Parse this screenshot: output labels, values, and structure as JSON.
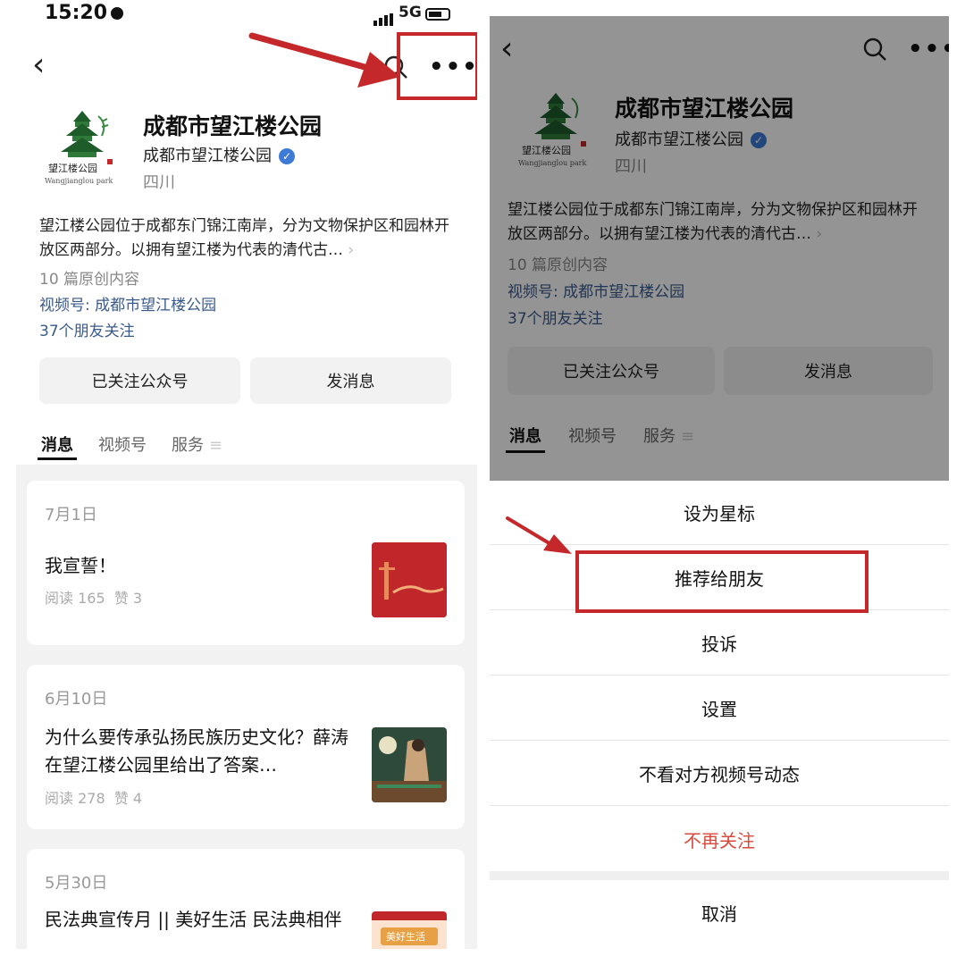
{
  "status": {
    "time": "15:20",
    "network": "5G"
  },
  "account": {
    "name": "成都市望江楼公园",
    "subject": "成都市望江楼公园",
    "region": "四川",
    "description": "望江楼公园位于成都东门锦江南岸，分为文物保护区和园林开放区两部分。以拥有望江楼为代表的清代古…",
    "original_count": "10 篇原创内容",
    "channel": "视频号: 成都市望江楼公园",
    "friends_following": "37个朋友关注",
    "logo_text": "望江楼公园",
    "logo_subtext": "Wangjianglou park"
  },
  "actions": {
    "followed": "已关注公众号",
    "message": "发消息"
  },
  "tabs": [
    "消息",
    "视频号",
    "服务"
  ],
  "articles": [
    {
      "date": "7月1日",
      "title": "我宣誓！",
      "reads": "阅读 165",
      "likes": "赞 3"
    },
    {
      "date": "6月10日",
      "title": "为什么要传承弘扬民族历史文化？薛涛在望江楼公园里给出了答案…",
      "reads": "阅读 278",
      "likes": "赞 4"
    },
    {
      "date": "5月30日",
      "title": "民法典宣传月 || 美好生活 民法典相伴",
      "reads": "",
      "likes": "",
      "thumb_text": "美好生活"
    }
  ],
  "menu": {
    "star": "设为星标",
    "recommend": "推荐给朋友",
    "report": "投诉",
    "settings": "设置",
    "mute_channel": "不看对方视频号动态",
    "unfollow": "不再关注",
    "cancel": "取消"
  },
  "colors": {
    "highlight": "#c4282a",
    "link": "#3a5a8c",
    "danger": "#d94a3c",
    "verified": "#3d7bd6"
  }
}
